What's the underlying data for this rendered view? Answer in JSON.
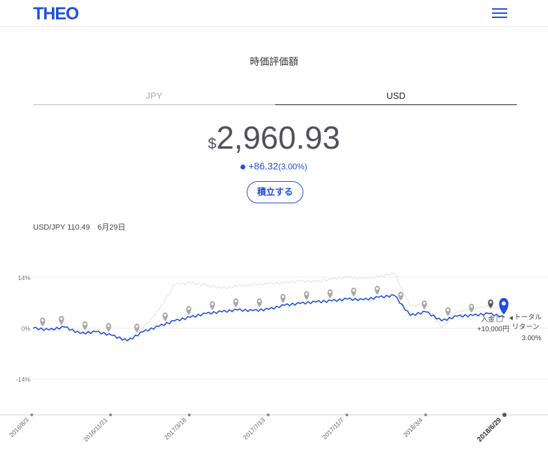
{
  "header": {
    "logo": "THEO",
    "menu_icon": "hamburger-menu-icon"
  },
  "title": "時価評価額",
  "tabs": [
    {
      "label": "JPY",
      "active": false
    },
    {
      "label": "USD",
      "active": true
    }
  ],
  "valuation": {
    "currency_symbol": "$",
    "amount": "2,960.93",
    "change": "+86.32",
    "change_pct": "(3.00%)"
  },
  "button_label": "積立する",
  "fx_info": "USD/JPY 110.49　6月29日",
  "colors": {
    "brand": "#1f4fd8",
    "benchmark": "#e3e6ee",
    "marker": "#a8a8a8"
  },
  "chart_data": {
    "type": "line",
    "ylabels": [
      "14%",
      "0%",
      "-14%"
    ],
    "ylim": [
      -22,
      18
    ],
    "x_labels": [
      "2016/8/3",
      "2016/11/21",
      "2017/3/18",
      "2017/7/13",
      "2017/11/7",
      "2018/3/4",
      "2018/6/29"
    ],
    "series": [
      {
        "values": [
          0,
          -0.5,
          0.3,
          -1.5,
          -1,
          -2,
          -3.5,
          -1,
          0.5,
          2,
          3,
          4,
          4.5,
          5,
          4.8,
          5.2,
          6.3,
          6.8,
          7.2,
          7.5,
          8,
          7.8,
          8.5,
          9,
          3.5,
          4.5,
          2,
          3.3,
          3.5,
          4,
          3
        ]
      },
      {
        "values": [
          0,
          -0.5,
          0,
          -1,
          -1,
          -2,
          -3,
          0,
          5,
          12,
          12.5,
          11.8,
          11,
          11.5,
          12,
          12.2,
          12.5,
          13,
          12.7,
          13.5,
          14,
          13.6,
          14.2,
          15,
          6,
          6.8,
          0,
          4.5,
          5.5,
          6,
          5
        ]
      }
    ],
    "markers": [
      {
        "x": 0.02,
        "label": ""
      },
      {
        "x": 0.06,
        "label": ""
      },
      {
        "x": 0.11,
        "label": ""
      },
      {
        "x": 0.16,
        "label": ""
      },
      {
        "x": 0.22,
        "label": ""
      },
      {
        "x": 0.28,
        "label": ""
      },
      {
        "x": 0.33,
        "label": ""
      },
      {
        "x": 0.38,
        "label": ""
      },
      {
        "x": 0.43,
        "label": ""
      },
      {
        "x": 0.48,
        "label": ""
      },
      {
        "x": 0.53,
        "label": ""
      },
      {
        "x": 0.58,
        "label": ""
      },
      {
        "x": 0.63,
        "label": ""
      },
      {
        "x": 0.68,
        "label": ""
      },
      {
        "x": 0.73,
        "label": ""
      },
      {
        "x": 0.78,
        "label": ""
      },
      {
        "x": 0.83,
        "label": ""
      },
      {
        "x": 0.88,
        "label": ""
      },
      {
        "x": 0.93,
        "label": ""
      }
    ],
    "deposit": {
      "label": "入金",
      "amount": "+10,000円"
    },
    "total_return": {
      "label_1": "トータル",
      "label_2": "リターン",
      "value": "3.00%"
    }
  }
}
